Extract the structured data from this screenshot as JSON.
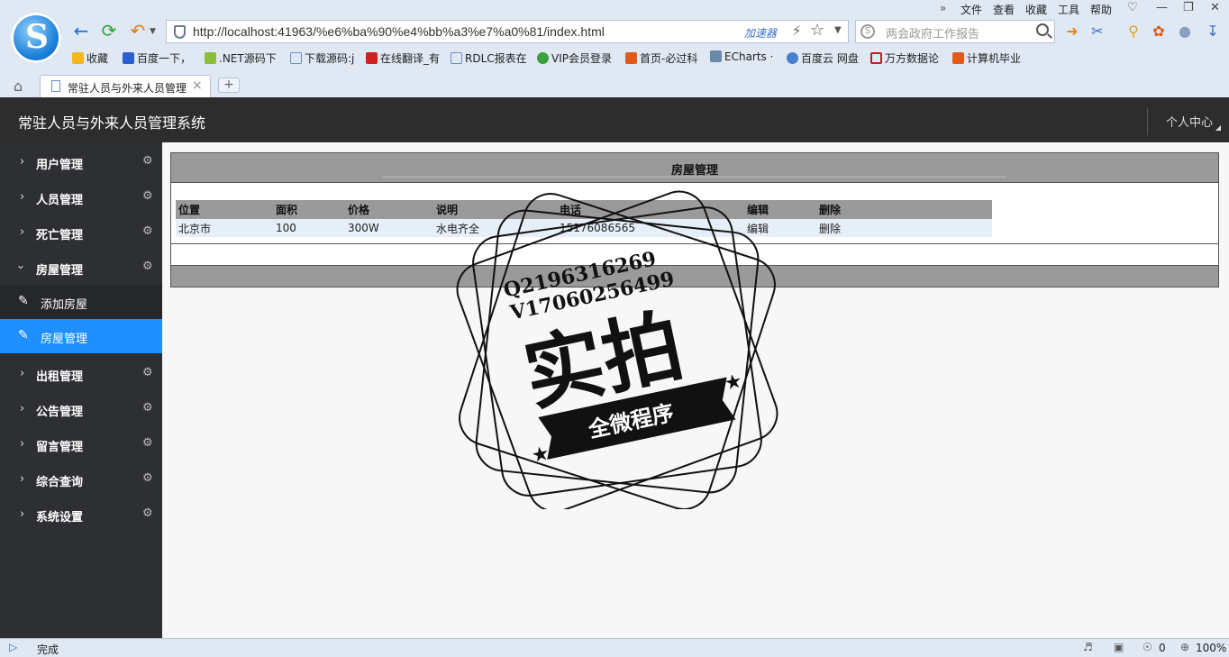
{
  "browser": {
    "url": "http://localhost:41963/%e6%ba%90%e4%bb%a3%e7%a0%81/index.html",
    "accelerator": "加速器",
    "search_placeholder": "两会政府工作报告",
    "menu": [
      "文件",
      "查看",
      "收藏",
      "工具",
      "帮助"
    ],
    "bookmarks": [
      "收藏",
      "百度一下，",
      ".NET源码下",
      "下载源码:j",
      "在线翻译_有",
      "RDLC报表在",
      "VIP会员登录",
      "首页-必过科",
      "ECharts ·",
      "百度云 网盘",
      "万方数据论",
      "计算机毕业"
    ],
    "tab_title": "常驻人员与外来人员管理",
    "status": "完成",
    "zoom": "100%",
    "count": "0"
  },
  "app": {
    "title": "常驻人员与外来人员管理系统",
    "personal_center": "个人中心"
  },
  "sidebar": {
    "items": [
      {
        "label": "用户管理"
      },
      {
        "label": "人员管理"
      },
      {
        "label": "死亡管理"
      },
      {
        "label": "房屋管理"
      },
      {
        "label": "出租管理"
      },
      {
        "label": "公告管理"
      },
      {
        "label": "留言管理"
      },
      {
        "label": "综合查询"
      },
      {
        "label": "系统设置"
      }
    ],
    "subitems": [
      {
        "label": "添加房屋"
      },
      {
        "label": "房屋管理"
      }
    ]
  },
  "panel": {
    "title": "房屋管理",
    "columns": [
      "位置",
      "面积",
      "价格",
      "说明",
      "电话",
      "编辑",
      "删除"
    ],
    "rows": [
      [
        "北京市",
        "100",
        "300W",
        "水电齐全",
        "15176086565",
        "编辑",
        "删除"
      ]
    ]
  },
  "watermark": {
    "line1": "Q2196316269",
    "line2": "V17060256499",
    "big": "实拍",
    "banner": "全微程序"
  }
}
